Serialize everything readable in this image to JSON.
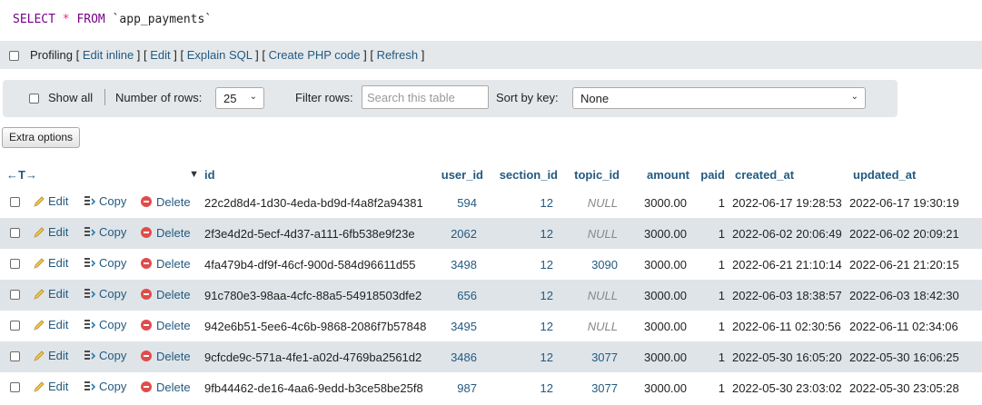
{
  "query": {
    "select": "SELECT",
    "star": "*",
    "from": "FROM",
    "table": "`app_payments`"
  },
  "profiling": {
    "label": "Profiling",
    "links": [
      "Edit inline",
      "Edit",
      "Explain SQL",
      "Create PHP code",
      "Refresh"
    ]
  },
  "nav": {
    "show_all": "Show all",
    "rows_label": "Number of rows:",
    "rows_value": "25",
    "filter_label": "Filter rows:",
    "filter_placeholder": "Search this table",
    "sort_label": "Sort by key:",
    "sort_value": "None"
  },
  "extra_options": "Extra options",
  "table": {
    "nav_arrows": "←T→",
    "sort_indicator": "▼",
    "columns": [
      "id",
      "user_id",
      "section_id",
      "topic_id",
      "amount",
      "paid",
      "created_at",
      "updated_at"
    ],
    "actions": {
      "edit": "Edit",
      "copy": "Copy",
      "delete": "Delete"
    },
    "rows": [
      {
        "id": "22c2d8d4-1d30-4eda-bd9d-f4a8f2a94381",
        "user_id": "594",
        "section_id": "12",
        "topic_id": "NULL",
        "amount": "3000.00",
        "paid": "1",
        "created_at": "2022-06-17 19:28:53",
        "updated_at": "2022-06-17 19:30:19"
      },
      {
        "id": "2f3e4d2d-5ecf-4d37-a111-6fb538e9f23e",
        "user_id": "2062",
        "section_id": "12",
        "topic_id": "NULL",
        "amount": "3000.00",
        "paid": "1",
        "created_at": "2022-06-02 20:06:49",
        "updated_at": "2022-06-02 20:09:21"
      },
      {
        "id": "4fa479b4-df9f-46cf-900d-584d96611d55",
        "user_id": "3498",
        "section_id": "12",
        "topic_id": "3090",
        "amount": "3000.00",
        "paid": "1",
        "created_at": "2022-06-21 21:10:14",
        "updated_at": "2022-06-21 21:20:15"
      },
      {
        "id": "91c780e3-98aa-4cfc-88a5-54918503dfe2",
        "user_id": "656",
        "section_id": "12",
        "topic_id": "NULL",
        "amount": "3000.00",
        "paid": "1",
        "created_at": "2022-06-03 18:38:57",
        "updated_at": "2022-06-03 18:42:30"
      },
      {
        "id": "942e6b51-5ee6-4c6b-9868-2086f7b57848",
        "user_id": "3495",
        "section_id": "12",
        "topic_id": "NULL",
        "amount": "3000.00",
        "paid": "1",
        "created_at": "2022-06-11 02:30:56",
        "updated_at": "2022-06-11 02:34:06"
      },
      {
        "id": "9cfcde9c-571a-4fe1-a02d-4769ba2561d2",
        "user_id": "3486",
        "section_id": "12",
        "topic_id": "3077",
        "amount": "3000.00",
        "paid": "1",
        "created_at": "2022-05-30 16:05:20",
        "updated_at": "2022-05-30 16:06:25"
      },
      {
        "id": "9fb44462-de16-4aa6-9edd-b3ce58be25f8",
        "user_id": "987",
        "section_id": "12",
        "topic_id": "3077",
        "amount": "3000.00",
        "paid": "1",
        "created_at": "2022-05-30 23:03:02",
        "updated_at": "2022-05-30 23:05:28"
      }
    ]
  }
}
